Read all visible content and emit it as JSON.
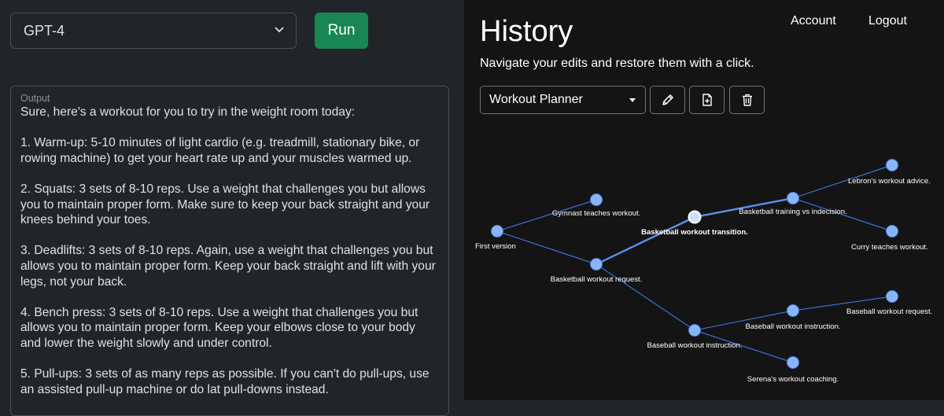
{
  "left": {
    "model_select": {
      "value": "GPT-4"
    },
    "run_button": {
      "label": "Run"
    },
    "output": {
      "label": "Output",
      "text": "Sure, here's a workout for you to try in the weight room today:\n\n1. Warm-up: 5-10 minutes of light cardio (e.g. treadmill, stationary bike, or rowing machine) to get your heart rate up and your muscles warmed up.\n\n2. Squats: 3 sets of 8-10 reps. Use a weight that challenges you but allows you to maintain proper form. Make sure to keep your back straight and your knees behind your toes.\n\n3. Deadlifts: 3 sets of 8-10 reps. Again, use a weight that challenges you but allows you to maintain proper form. Keep your back straight and lift with your legs, not your back.\n\n4. Bench press: 3 sets of 8-10 reps. Use a weight that challenges you but allows you to maintain proper form. Keep your elbows close to your body and lower the weight slowly and under control.\n\n5. Pull-ups: 3 sets of as many reps as possible. If you can't do pull-ups, use an assisted pull-up machine or do lat pull-downs instead."
    }
  },
  "history": {
    "title": "History",
    "subtitle": "Navigate your edits and restore them with a click.",
    "nav": {
      "account": "Account",
      "logout": "Logout"
    },
    "project_select": {
      "value": "Workout Planner"
    },
    "toolbar_icons": [
      "pencil-icon",
      "file-plus-icon",
      "trash-icon"
    ],
    "tree": {
      "nodes": [
        {
          "id": "n1",
          "label": "First version",
          "selected": false
        },
        {
          "id": "n2",
          "label": "Gymnast teaches workout.",
          "selected": false
        },
        {
          "id": "n3",
          "label": "Basketball workout request.",
          "selected": false
        },
        {
          "id": "n4",
          "label": "Basketball workout transition.",
          "selected": true
        },
        {
          "id": "n5",
          "label": "Basketball training vs indecision.",
          "selected": false
        },
        {
          "id": "n6",
          "label": "Lebron's workout advice.",
          "selected": false
        },
        {
          "id": "n7",
          "label": "Curry teaches workout.",
          "selected": false
        },
        {
          "id": "n8",
          "label": "Baseball workout instruction.",
          "selected": false
        },
        {
          "id": "n9",
          "label": "Baseball workout instruction.",
          "selected": false
        },
        {
          "id": "n10",
          "label": "Baseball workout request.",
          "selected": false
        },
        {
          "id": "n11",
          "label": "Serena's workout coaching.",
          "selected": false
        }
      ],
      "edges": [
        [
          "n1",
          "n2"
        ],
        [
          "n1",
          "n3"
        ],
        [
          "n3",
          "n4"
        ],
        [
          "n4",
          "n5"
        ],
        [
          "n5",
          "n6"
        ],
        [
          "n5",
          "n7"
        ],
        [
          "n3",
          "n8"
        ],
        [
          "n8",
          "n9"
        ],
        [
          "n9",
          "n10"
        ],
        [
          "n8",
          "n11"
        ]
      ],
      "highlighted_path": [
        "n3",
        "n4",
        "n5"
      ]
    },
    "colors": {
      "node_fill": "#8ab4f8",
      "node_stroke": "#4a7fd8",
      "edge": "#3b6fd6",
      "selected_node": "#cfe0ff"
    }
  }
}
